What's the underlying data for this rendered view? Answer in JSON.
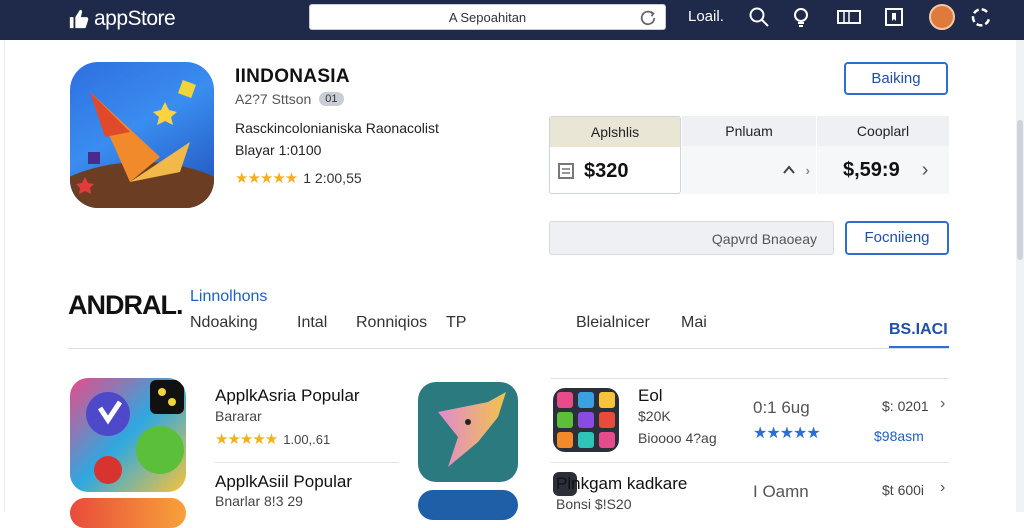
{
  "header": {
    "logo": "appStore",
    "search_text": "A Sepoahitan",
    "login": "Loail.",
    "icons": [
      "search-icon",
      "lightbulb-icon",
      "card-icon",
      "bookmark-icon",
      "avatar",
      "refresh-icon"
    ]
  },
  "app": {
    "title": "IINDONASIA",
    "meta": "A2?7 Sttson",
    "badge": "01",
    "description": "Rasckincolonianiska Raonacolist",
    "developer": "Blayar  1:0100",
    "rating_text": "1 2:00,55",
    "stars": 4.5
  },
  "buttons": {
    "top_right": "Baiking",
    "secondary": "Focniieng"
  },
  "price_table": {
    "columns": [
      {
        "head": "Aplshlis",
        "value": "$320"
      },
      {
        "head": "Pnluam",
        "value": ""
      },
      {
        "head": "Cooplarl",
        "value": "$,59:9"
      }
    ]
  },
  "wide_field": "Qapvrd Bnaoeay",
  "section": {
    "title": "ANDRAL.",
    "link": "Linnolhons",
    "tabs": [
      "Ndoaking",
      "Intal",
      "Ronniqios",
      "TP",
      "Bleialnicer",
      "Mai",
      "BS.IACI"
    ]
  },
  "left_list": [
    {
      "title": "ApplkAsria Popular",
      "sub": "Bararar",
      "rating": "1.00,.61",
      "stars": 4.5
    },
    {
      "title": "ApplkAsiil Popular",
      "sub": "Bnarlar   8!3 29"
    }
  ],
  "right_list": [
    {
      "title": "Eol",
      "sub1": "$20K",
      "sub2": "Bioooo 4?ag",
      "score": "0:1 6ug",
      "price": "$:  0201",
      "link": "$98asm"
    },
    {
      "title": "Plnkgam kadkare",
      "sub1": "Bonsi   $!S20",
      "score": "I Oamn",
      "price": "$t  600i"
    }
  ]
}
